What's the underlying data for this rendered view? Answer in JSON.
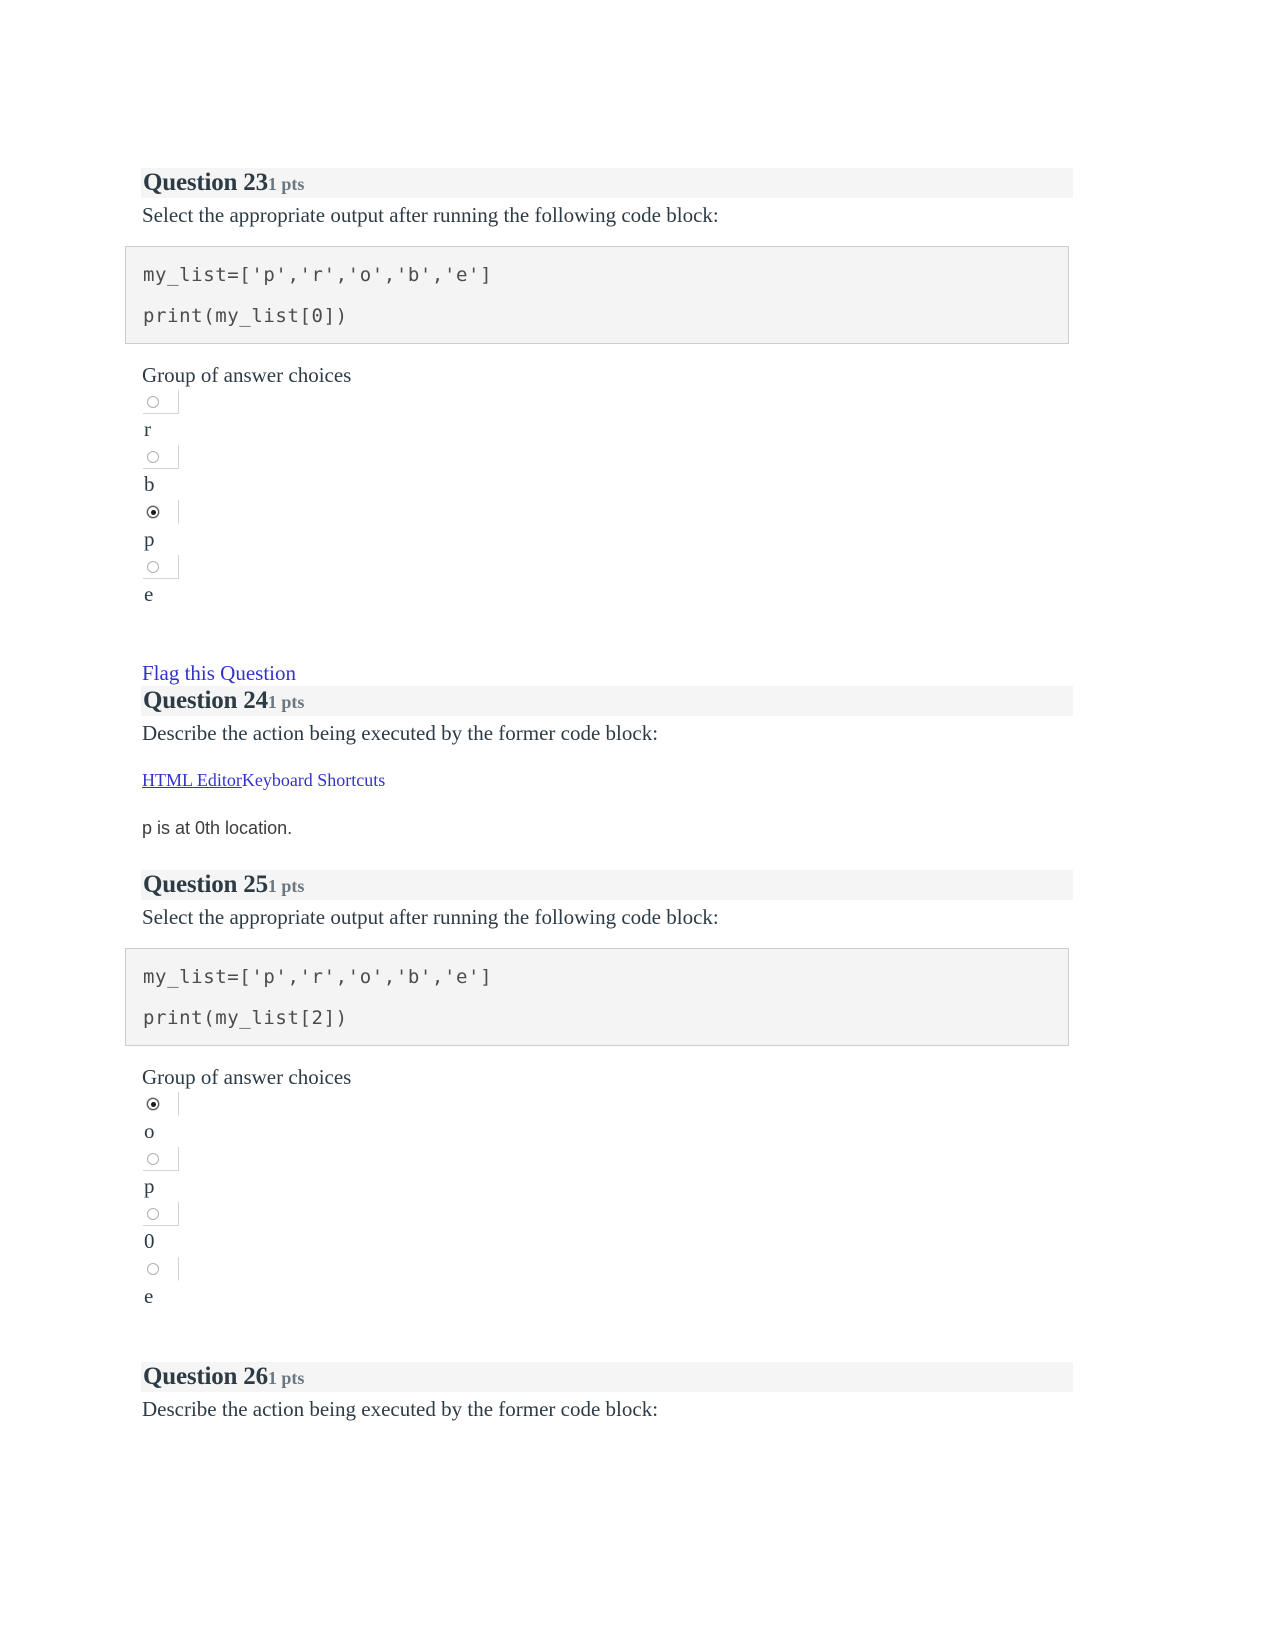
{
  "quiz": {
    "questions": [
      {
        "title": "Question 23",
        "points": "1 pts",
        "prompt": "Select the appropriate output after running the following code block:",
        "code": {
          "line1": "my_list=['p','r','o','b','e']",
          "line2": "print(my_list[0])"
        },
        "answers_label": "Group of answer choices",
        "choices": [
          {
            "label": "r",
            "selected": false
          },
          {
            "label": "b",
            "selected": false
          },
          {
            "label": "p",
            "selected": true
          },
          {
            "label": "e",
            "selected": false
          }
        ],
        "flag_label": "Flag this Question"
      },
      {
        "title": "Question 24",
        "points": "1 pts",
        "prompt": "Describe the action being executed by the former code block:",
        "editor": {
          "html_editor_label": "HTML Editor",
          "keyboard_shortcuts_label": "Keyboard Shortcuts"
        },
        "response": "p is at 0th location."
      },
      {
        "title": "Question 25",
        "points": "1 pts",
        "prompt": "Select the appropriate output after running the following code block:",
        "code": {
          "line1": "my_list=['p','r','o','b','e']",
          "line2": "print(my_list[2])"
        },
        "answers_label": "Group of answer choices",
        "choices": [
          {
            "label": "o",
            "selected": true
          },
          {
            "label": "p",
            "selected": false
          },
          {
            "label": "0",
            "selected": false
          },
          {
            "label": "e",
            "selected": false
          }
        ]
      },
      {
        "title": "Question 26",
        "points": "1 pts",
        "prompt": "Describe the action being executed by the former code block:"
      }
    ]
  },
  "colors": {
    "header_bar": "#f5f5f5",
    "code_bg": "#f4f4f4",
    "code_border": "#cccccc",
    "link": "#3333cc",
    "text": "#2d3b45",
    "points_text": "#6b7780"
  }
}
